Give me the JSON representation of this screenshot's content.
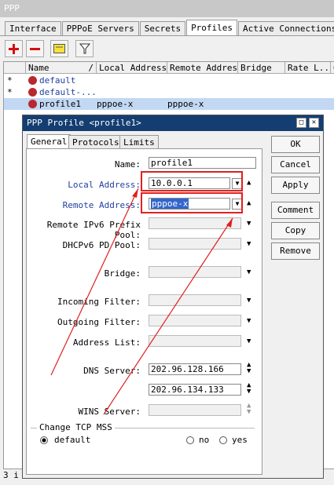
{
  "window": {
    "title": "PPP"
  },
  "tabs": [
    "Interface",
    "PPPoE Servers",
    "Secrets",
    "Profiles",
    "Active Connections"
  ],
  "toolbar": {
    "icons": [
      "add-icon",
      "remove-icon",
      "comment-icon",
      "filter-icon"
    ]
  },
  "table": {
    "columns": [
      "Name",
      "Local Address",
      "Remote Address",
      "Bridge",
      "Rate L...",
      "O"
    ],
    "rows": [
      {
        "flag": "*",
        "name": "default",
        "local": "",
        "remote": ""
      },
      {
        "flag": "*",
        "name": "default-...",
        "local": "",
        "remote": ""
      },
      {
        "flag": "",
        "name": "profile1",
        "local": "pppoe-x",
        "remote": "pppoe-x"
      }
    ]
  },
  "status": "3 i",
  "dialog": {
    "title": "PPP Profile <profile1>",
    "tabs": [
      "General",
      "Protocols",
      "Limits"
    ],
    "fields": {
      "name": {
        "label": "Name:",
        "value": "profile1"
      },
      "local_address": {
        "label": "Local Address:",
        "value": "10.0.0.1"
      },
      "remote_address": {
        "label": "Remote Address:",
        "value": "pppoe-x"
      },
      "remote_ipv6_prefix_pool": {
        "label": "Remote IPv6 Prefix Pool:",
        "value": ""
      },
      "dhcpv6_pd_pool": {
        "label": "DHCPv6 PD Pool:",
        "value": ""
      },
      "bridge": {
        "label": "Bridge:",
        "value": ""
      },
      "incoming_filter": {
        "label": "Incoming Filter:",
        "value": ""
      },
      "outgoing_filter": {
        "label": "Outgoing Filter:",
        "value": ""
      },
      "address_list": {
        "label": "Address List:",
        "value": ""
      },
      "dns_server": {
        "label": "DNS Server:",
        "value1": "202.96.128.166",
        "value2": "202.96.134.133"
      },
      "wins_server": {
        "label": "WINS Server:",
        "value": ""
      }
    },
    "tcp_mss": {
      "legend": "Change TCP MSS",
      "options": [
        "default",
        "no",
        "yes"
      ],
      "selected": "default"
    },
    "buttons": [
      "OK",
      "Cancel",
      "Apply",
      "Comment",
      "Copy",
      "Remove"
    ]
  },
  "colors": {
    "dialog_title_bg": "#143e72",
    "selection": "#c2d8f3",
    "annotation": "#e02020",
    "label_blue": "#1f3fa0"
  }
}
